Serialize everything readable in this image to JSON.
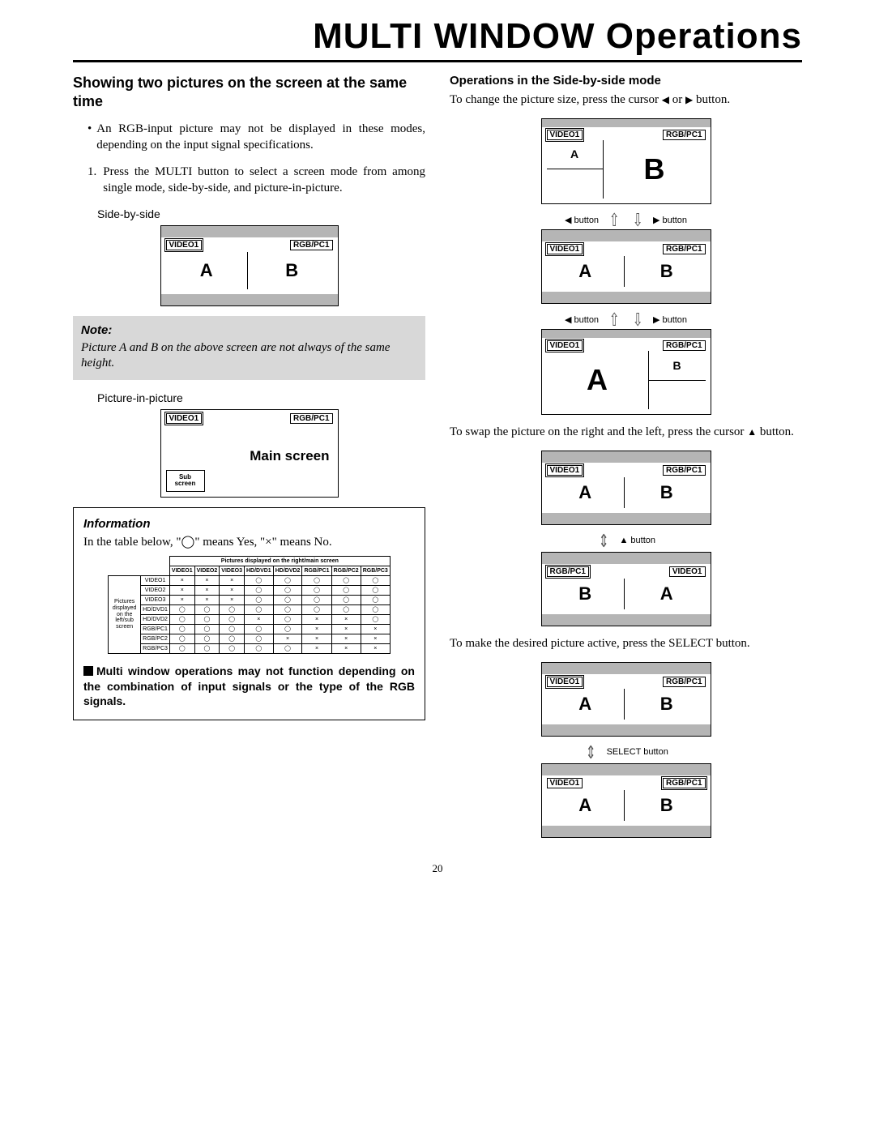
{
  "title": "MULTI WINDOW Operations",
  "left": {
    "heading": "Showing two pictures on the screen at the same time",
    "bullet": "An RGB-input picture may not be displayed in these modes, depending on the input signal specifications.",
    "step1": "Press the MULTI button to select a screen mode from among single mode, side-by-side, and picture-in-picture.",
    "sbs_label": "Side-by-side",
    "pip_label": "Picture-in-picture",
    "note_title": "Note:",
    "note_body": "Picture A and B on the above screen are not always of the same height.",
    "screen": {
      "video1": "VIDEO1",
      "rgbpc1": "RGB/PC1",
      "A": "A",
      "B": "B",
      "sub": "Sub\nscreen",
      "main": "Main screen"
    }
  },
  "info": {
    "title": "Information",
    "intro": "In the table below, \"◯\" means Yes, \"×\" means No.",
    "top_header": "Pictures displayed on the right/main screen",
    "side_header": "Pictures displayed on the left/sub screen",
    "cols": [
      "VIDEO1",
      "VIDEO2",
      "VIDEO3",
      "HD/DVD1",
      "HD/DVD2",
      "RGB/PC1",
      "RGB/PC2",
      "RGB/PC3"
    ],
    "rows": [
      {
        "name": "VIDEO1",
        "cells": [
          "×",
          "×",
          "×",
          "◯",
          "◯",
          "◯",
          "◯",
          "◯"
        ]
      },
      {
        "name": "VIDEO2",
        "cells": [
          "×",
          "×",
          "×",
          "◯",
          "◯",
          "◯",
          "◯",
          "◯"
        ]
      },
      {
        "name": "VIDEO3",
        "cells": [
          "×",
          "×",
          "×",
          "◯",
          "◯",
          "◯",
          "◯",
          "◯"
        ]
      },
      {
        "name": "HD/DVD1",
        "cells": [
          "◯",
          "◯",
          "◯",
          "◯",
          "◯",
          "◯",
          "◯",
          "◯"
        ]
      },
      {
        "name": "HD/DVD2",
        "cells": [
          "◯",
          "◯",
          "◯",
          "×",
          "◯",
          "×",
          "×",
          "◯"
        ]
      },
      {
        "name": "RGB/PC1",
        "cells": [
          "◯",
          "◯",
          "◯",
          "◯",
          "◯",
          "×",
          "×",
          "×"
        ]
      },
      {
        "name": "RGB/PC2",
        "cells": [
          "◯",
          "◯",
          "◯",
          "◯",
          "×",
          "×",
          "×",
          "×"
        ]
      },
      {
        "name": "RGB/PC3",
        "cells": [
          "◯",
          "◯",
          "◯",
          "◯",
          "◯",
          "×",
          "×",
          "×"
        ]
      }
    ],
    "footnote": "Multi window operations may not function depending on the combination of input signals or the type of the RGB signals."
  },
  "right": {
    "heading": "Operations in the Side-by-side mode",
    "p1_a": "To change the picture size, press the cursor ",
    "p1_b": " or ",
    "p1_c": " button.",
    "btn_left": "◀ button",
    "btn_right": "▶ button",
    "btn_up": "▲ button",
    "btn_select": "SELECT button",
    "p2_a": "To swap the picture on the right and the left, press the cursor ",
    "p2_b": " button.",
    "p3": "To make the desired picture active, press the SELECT button.",
    "video1": "VIDEO1",
    "rgbpc1": "RGB/PC1",
    "A": "A",
    "B": "B"
  },
  "page": "20"
}
